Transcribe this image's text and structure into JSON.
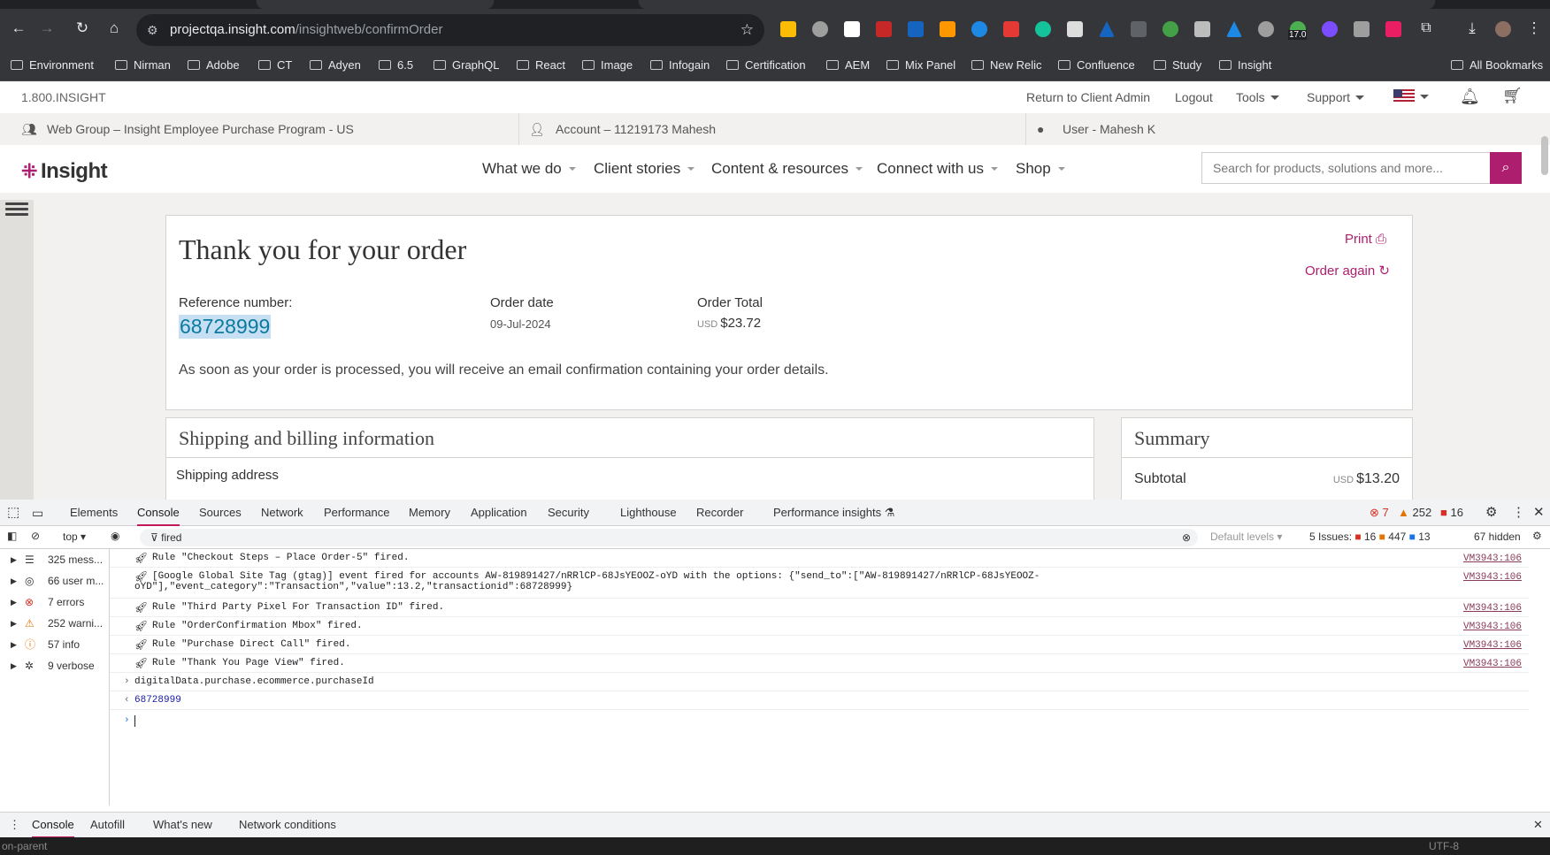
{
  "browser": {
    "url_host": "projectqa.insight.com",
    "url_path": "/insightweb/confirmOrder",
    "ext_badge": "17.0",
    "bookmarks": [
      "Environment",
      "Nirman",
      "Adobe",
      "CT",
      "Adyen",
      "6.5",
      "GraphQL",
      "React",
      "Image",
      "Infogain",
      "Certification",
      "AEM",
      "Mix Panel",
      "New Relic",
      "Confluence",
      "Study",
      "Insight"
    ],
    "all_bookmarks": "All Bookmarks"
  },
  "util": {
    "phone": "1.800.INSIGHT",
    "return_admin": "Return to Client Admin",
    "logout": "Logout",
    "tools": "Tools",
    "support": "Support"
  },
  "account_bar": {
    "web_group": "Web Group – Insight Employee Purchase Program - US",
    "account": "Account – 11219173 Mahesh",
    "user": "User - Mahesh K"
  },
  "nav": {
    "logo": "Insight",
    "items": [
      "What we do",
      "Client stories",
      "Content & resources",
      "Connect with us",
      "Shop"
    ],
    "search_placeholder": "Search for products, solutions and more..."
  },
  "order": {
    "title": "Thank you for your order",
    "ref_label": "Reference number:",
    "ref_value": "68728999",
    "date_label": "Order date",
    "date_value": "09-Jul-2024",
    "total_label": "Order Total",
    "total_currency": "USD",
    "total_value": "$23.72",
    "message": "As soon as your order is processed, you will receive an email confirmation containing your order details.",
    "print": "Print",
    "order_again": "Order again"
  },
  "shipping": {
    "title": "Shipping and billing information",
    "sub": "Shipping address"
  },
  "summary": {
    "title": "Summary",
    "subtotal_label": "Subtotal",
    "subtotal_currency": "USD",
    "subtotal_value": "$13.20"
  },
  "devtools": {
    "tabs": [
      "Elements",
      "Console",
      "Sources",
      "Network",
      "Performance",
      "Memory",
      "Application",
      "Security",
      "Lighthouse",
      "Recorder",
      "Performance insights"
    ],
    "errors": "7",
    "warnings": "252",
    "issues_badge": "16",
    "context": "top",
    "filter": "fired",
    "levels": "Default levels",
    "issues_label": "5 Issues:",
    "issues_err": "16",
    "issues_warn": "447",
    "issues_info": "13",
    "hidden": "67 hidden",
    "sidebar": [
      "325 mess...",
      "66 user m...",
      "7 errors",
      "252 warni...",
      "57 info",
      "9 verbose"
    ],
    "logs": [
      {
        "text": "Rule \"Checkout Steps  – Place Order-5\" fired.",
        "src": "VM3943:106"
      },
      {
        "text": "[Google Global Site Tag (gtag)] event fired for accounts AW-819891427/nRRlCP-68JsYEOOZ-oYD with the options: {\"send_to\":[\"AW-819891427/nRRlCP-68JsYEOOZ-",
        "text2": "oYD\"],\"event_category\":\"Transaction\",\"value\":13.2,\"transactionid\":68728999}",
        "src": "VM3943:106"
      },
      {
        "text": "Rule \"Third Party Pixel For Transaction ID\" fired.",
        "src": "VM3943:106"
      },
      {
        "text": "Rule \"OrderConfirmation Mbox\" fired.",
        "src": "VM3943:106"
      },
      {
        "text": "Rule \"Purchase Direct Call\" fired.",
        "src": "VM3943:106"
      },
      {
        "text": "Rule \"Thank You Page View\" fired.",
        "src": "VM3943:106"
      }
    ],
    "expr": "digitalData.purchase.ecommerce.purchaseId",
    "result": "68728999",
    "bottom_tabs": [
      "Console",
      "Autofill",
      "What's new",
      "Network conditions"
    ]
  },
  "status": {
    "left": "on-parent",
    "right": "UTF-8"
  }
}
